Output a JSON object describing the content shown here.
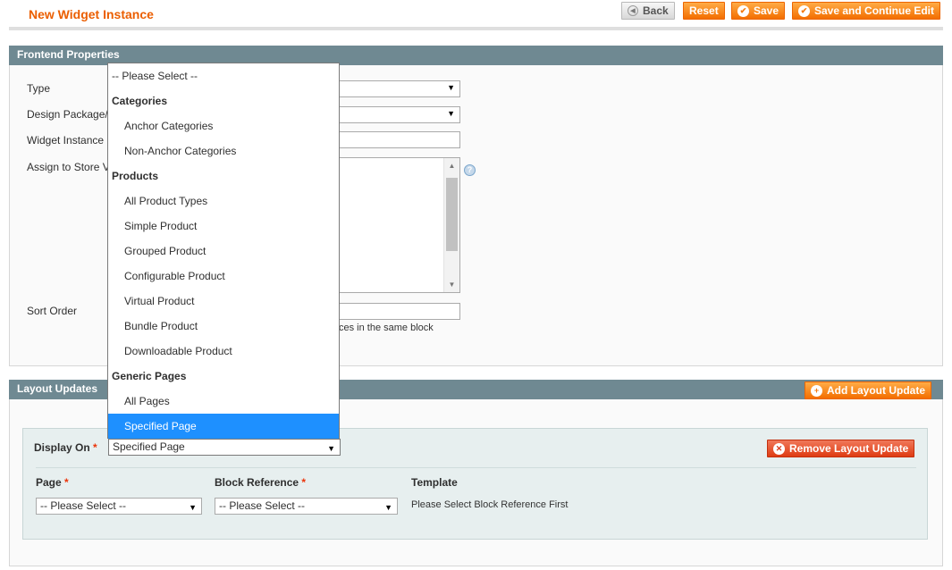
{
  "header": {
    "title": "New Widget Instance",
    "buttons": {
      "back": "Back",
      "reset": "Reset",
      "save": "Save",
      "save_continue": "Save and Continue Edit"
    }
  },
  "frontend": {
    "section_title": "Frontend Properties",
    "labels": {
      "type": "Type",
      "design_package": "Design Package/",
      "widget_instance": "Widget Instance",
      "assign_store": "Assign to Store V",
      "sort_order": "Sort Order"
    },
    "sort_order_note": "ces in the same block",
    "help": "?"
  },
  "layout_updates": {
    "section_title": "Layout Updates",
    "add_button": "Add Layout Update",
    "display_on_label": "Display On",
    "display_on_value": "Specified Page",
    "remove_button": "Remove Layout Update",
    "page_label": "Page",
    "page_value": "-- Please Select --",
    "block_ref_label": "Block Reference",
    "block_ref_value": "-- Please Select --",
    "template_label": "Template",
    "template_value": "Please Select Block Reference First",
    "required_mark": "*"
  },
  "dropdown": {
    "placeholder": "-- Please Select --",
    "categories_group": "Categories",
    "categories": [
      "Anchor Categories",
      "Non-Anchor Categories"
    ],
    "products_group": "Products",
    "products": [
      "All Product Types",
      "Simple Product",
      "Grouped Product",
      "Configurable Product",
      "Virtual Product",
      "Bundle Product",
      "Downloadable Product"
    ],
    "generic_group": "Generic Pages",
    "generic": [
      "All Pages",
      "Specified Page"
    ]
  },
  "icons": {
    "back": "back-arrow-icon",
    "save": "check-icon",
    "add": "plus-icon",
    "remove": "close-icon",
    "select_arrow": "chevron-down-icon",
    "help": "help-icon"
  }
}
